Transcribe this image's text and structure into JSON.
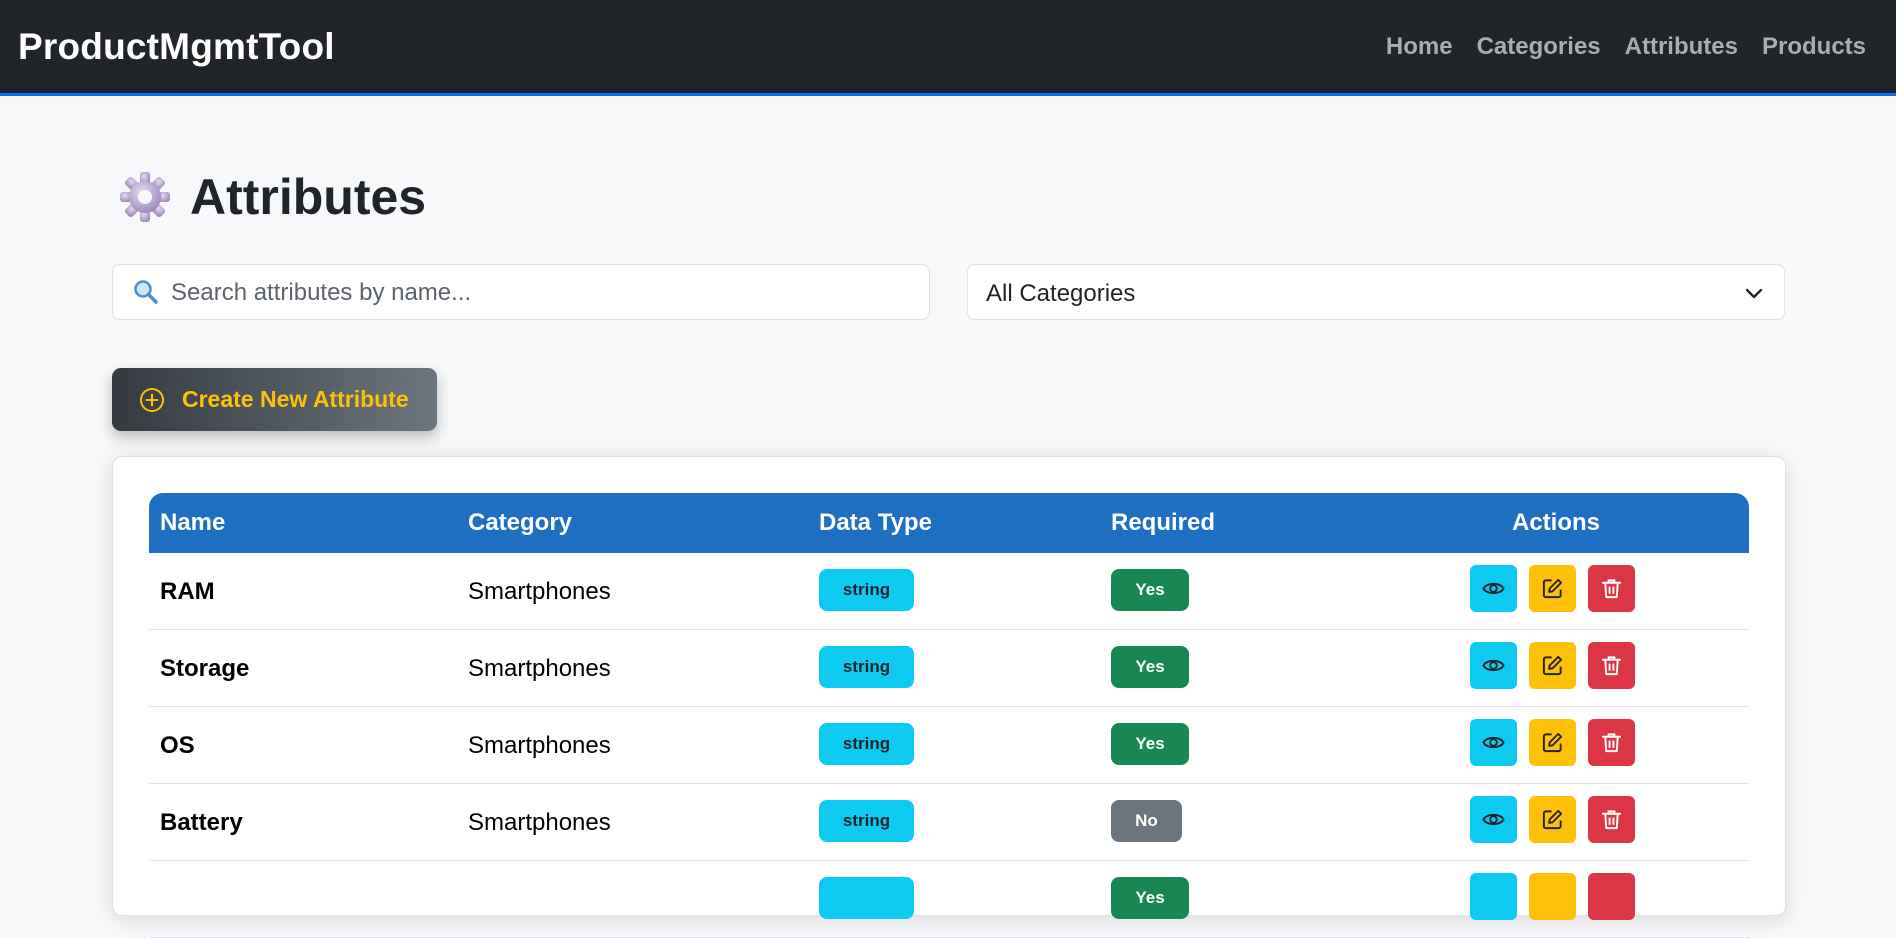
{
  "navbar": {
    "brand": "ProductMgmtTool",
    "links": [
      "Home",
      "Categories",
      "Attributes",
      "Products"
    ]
  },
  "page": {
    "title": "Attributes"
  },
  "search": {
    "placeholder": "Search attributes by name..."
  },
  "category_filter": {
    "selected": "All Categories"
  },
  "create_button": {
    "label": "Create New Attribute"
  },
  "table": {
    "headers": [
      "Name",
      "Category",
      "Data Type",
      "Required",
      "Actions"
    ],
    "rows": [
      {
        "name": "RAM",
        "category": "Smartphones",
        "data_type": "string",
        "required": "Yes"
      },
      {
        "name": "Storage",
        "category": "Smartphones",
        "data_type": "string",
        "required": "Yes"
      },
      {
        "name": "OS",
        "category": "Smartphones",
        "data_type": "string",
        "required": "Yes"
      },
      {
        "name": "Battery",
        "category": "Smartphones",
        "data_type": "string",
        "required": "No"
      },
      {
        "name": "",
        "category": "",
        "data_type": "",
        "required": "Yes"
      }
    ]
  },
  "colors": {
    "navbar_bg": "#212529",
    "table_header": "#1f6fc2",
    "badge_string": "#0dcaf0",
    "badge_yes": "#198754",
    "badge_no": "#6c757d",
    "view": "#0dcaf0",
    "edit": "#ffc107",
    "delete": "#dc3545",
    "create_label": "#ffc107"
  },
  "icons": [
    "gear-icon",
    "search-icon",
    "chevron-down-icon",
    "plus-circle-icon",
    "eye-icon",
    "edit-icon",
    "trash-icon"
  ]
}
